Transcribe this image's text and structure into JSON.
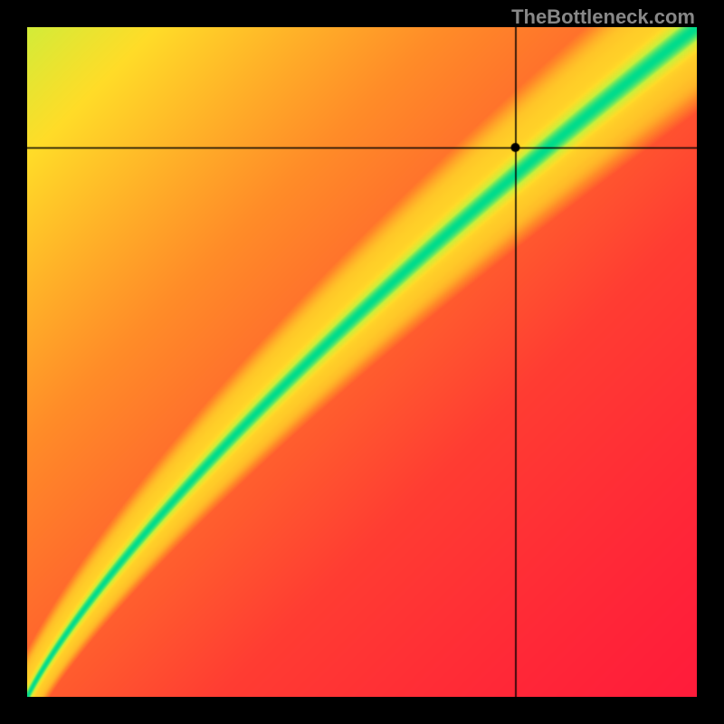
{
  "watermark": "TheBottleneck.com",
  "chart_data": {
    "type": "heatmap",
    "title": "",
    "xlabel": "",
    "ylabel": "",
    "xlim": [
      0,
      1
    ],
    "ylim": [
      0,
      1
    ],
    "marker": {
      "x": 0.73,
      "y": 0.82
    },
    "crosshair": {
      "x": 0.73,
      "y": 0.82
    },
    "note": "Heatmap of compatibility; green diagonal band indicates balanced pairing; red corners indicate severe bottleneck. No axis tick labels visible."
  },
  "colors": {
    "background": "#000000",
    "watermark": "#888888",
    "crosshair": "#000000",
    "marker_fill": "#000000"
  }
}
